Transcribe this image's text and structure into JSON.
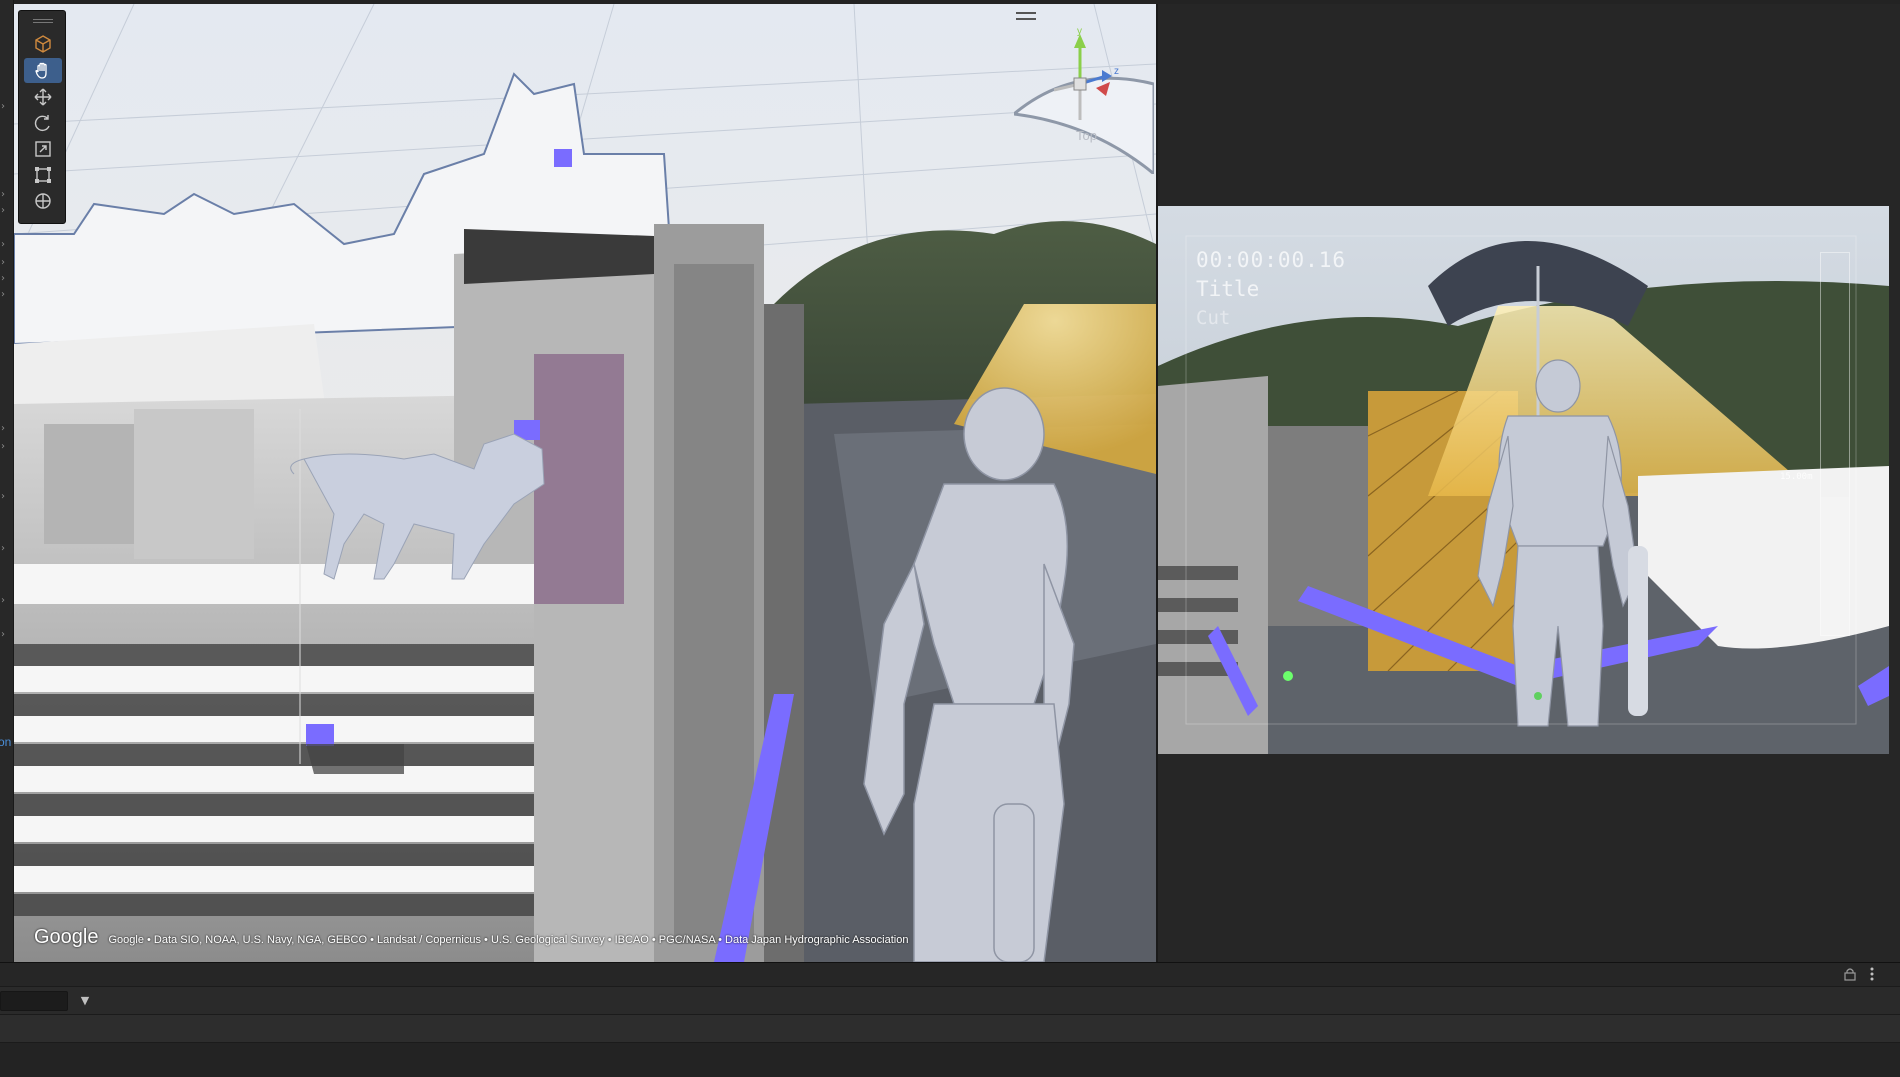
{
  "scene_view": {
    "tools": [
      {
        "name": "view-tool",
        "icon": "cube-icon"
      },
      {
        "name": "hand-tool",
        "icon": "hand-icon",
        "active": true
      },
      {
        "name": "move-tool",
        "icon": "move-icon"
      },
      {
        "name": "rotate-tool",
        "icon": "rotate-icon"
      },
      {
        "name": "scale-tool",
        "icon": "scale-icon"
      },
      {
        "name": "rect-tool",
        "icon": "rect-transform-icon"
      },
      {
        "name": "transform-tool",
        "icon": "transform-icon"
      }
    ],
    "gizmo_label": "Top",
    "gizmo_axes": {
      "y": "y",
      "z": "z"
    },
    "attribution_logo": "Google",
    "attribution_text": "Google • Data SIO, NOAA, U.S. Navy, NGA, GEBCO • Landsat / Copernicus • U.S. Geological Survey • IBCAO • PGC/NASA • Data Japan Hydrographic Association",
    "accent_color": "#7a6cff"
  },
  "game_view": {
    "timecode": "00:00:00.16",
    "title_label": "Title",
    "cut_label": "Cut",
    "depth_label": "15.00m",
    "depth_level": 0.36
  },
  "gutter": {
    "partial_label": "on"
  },
  "timeline": {
    "dropdown_symbol": "▼"
  }
}
